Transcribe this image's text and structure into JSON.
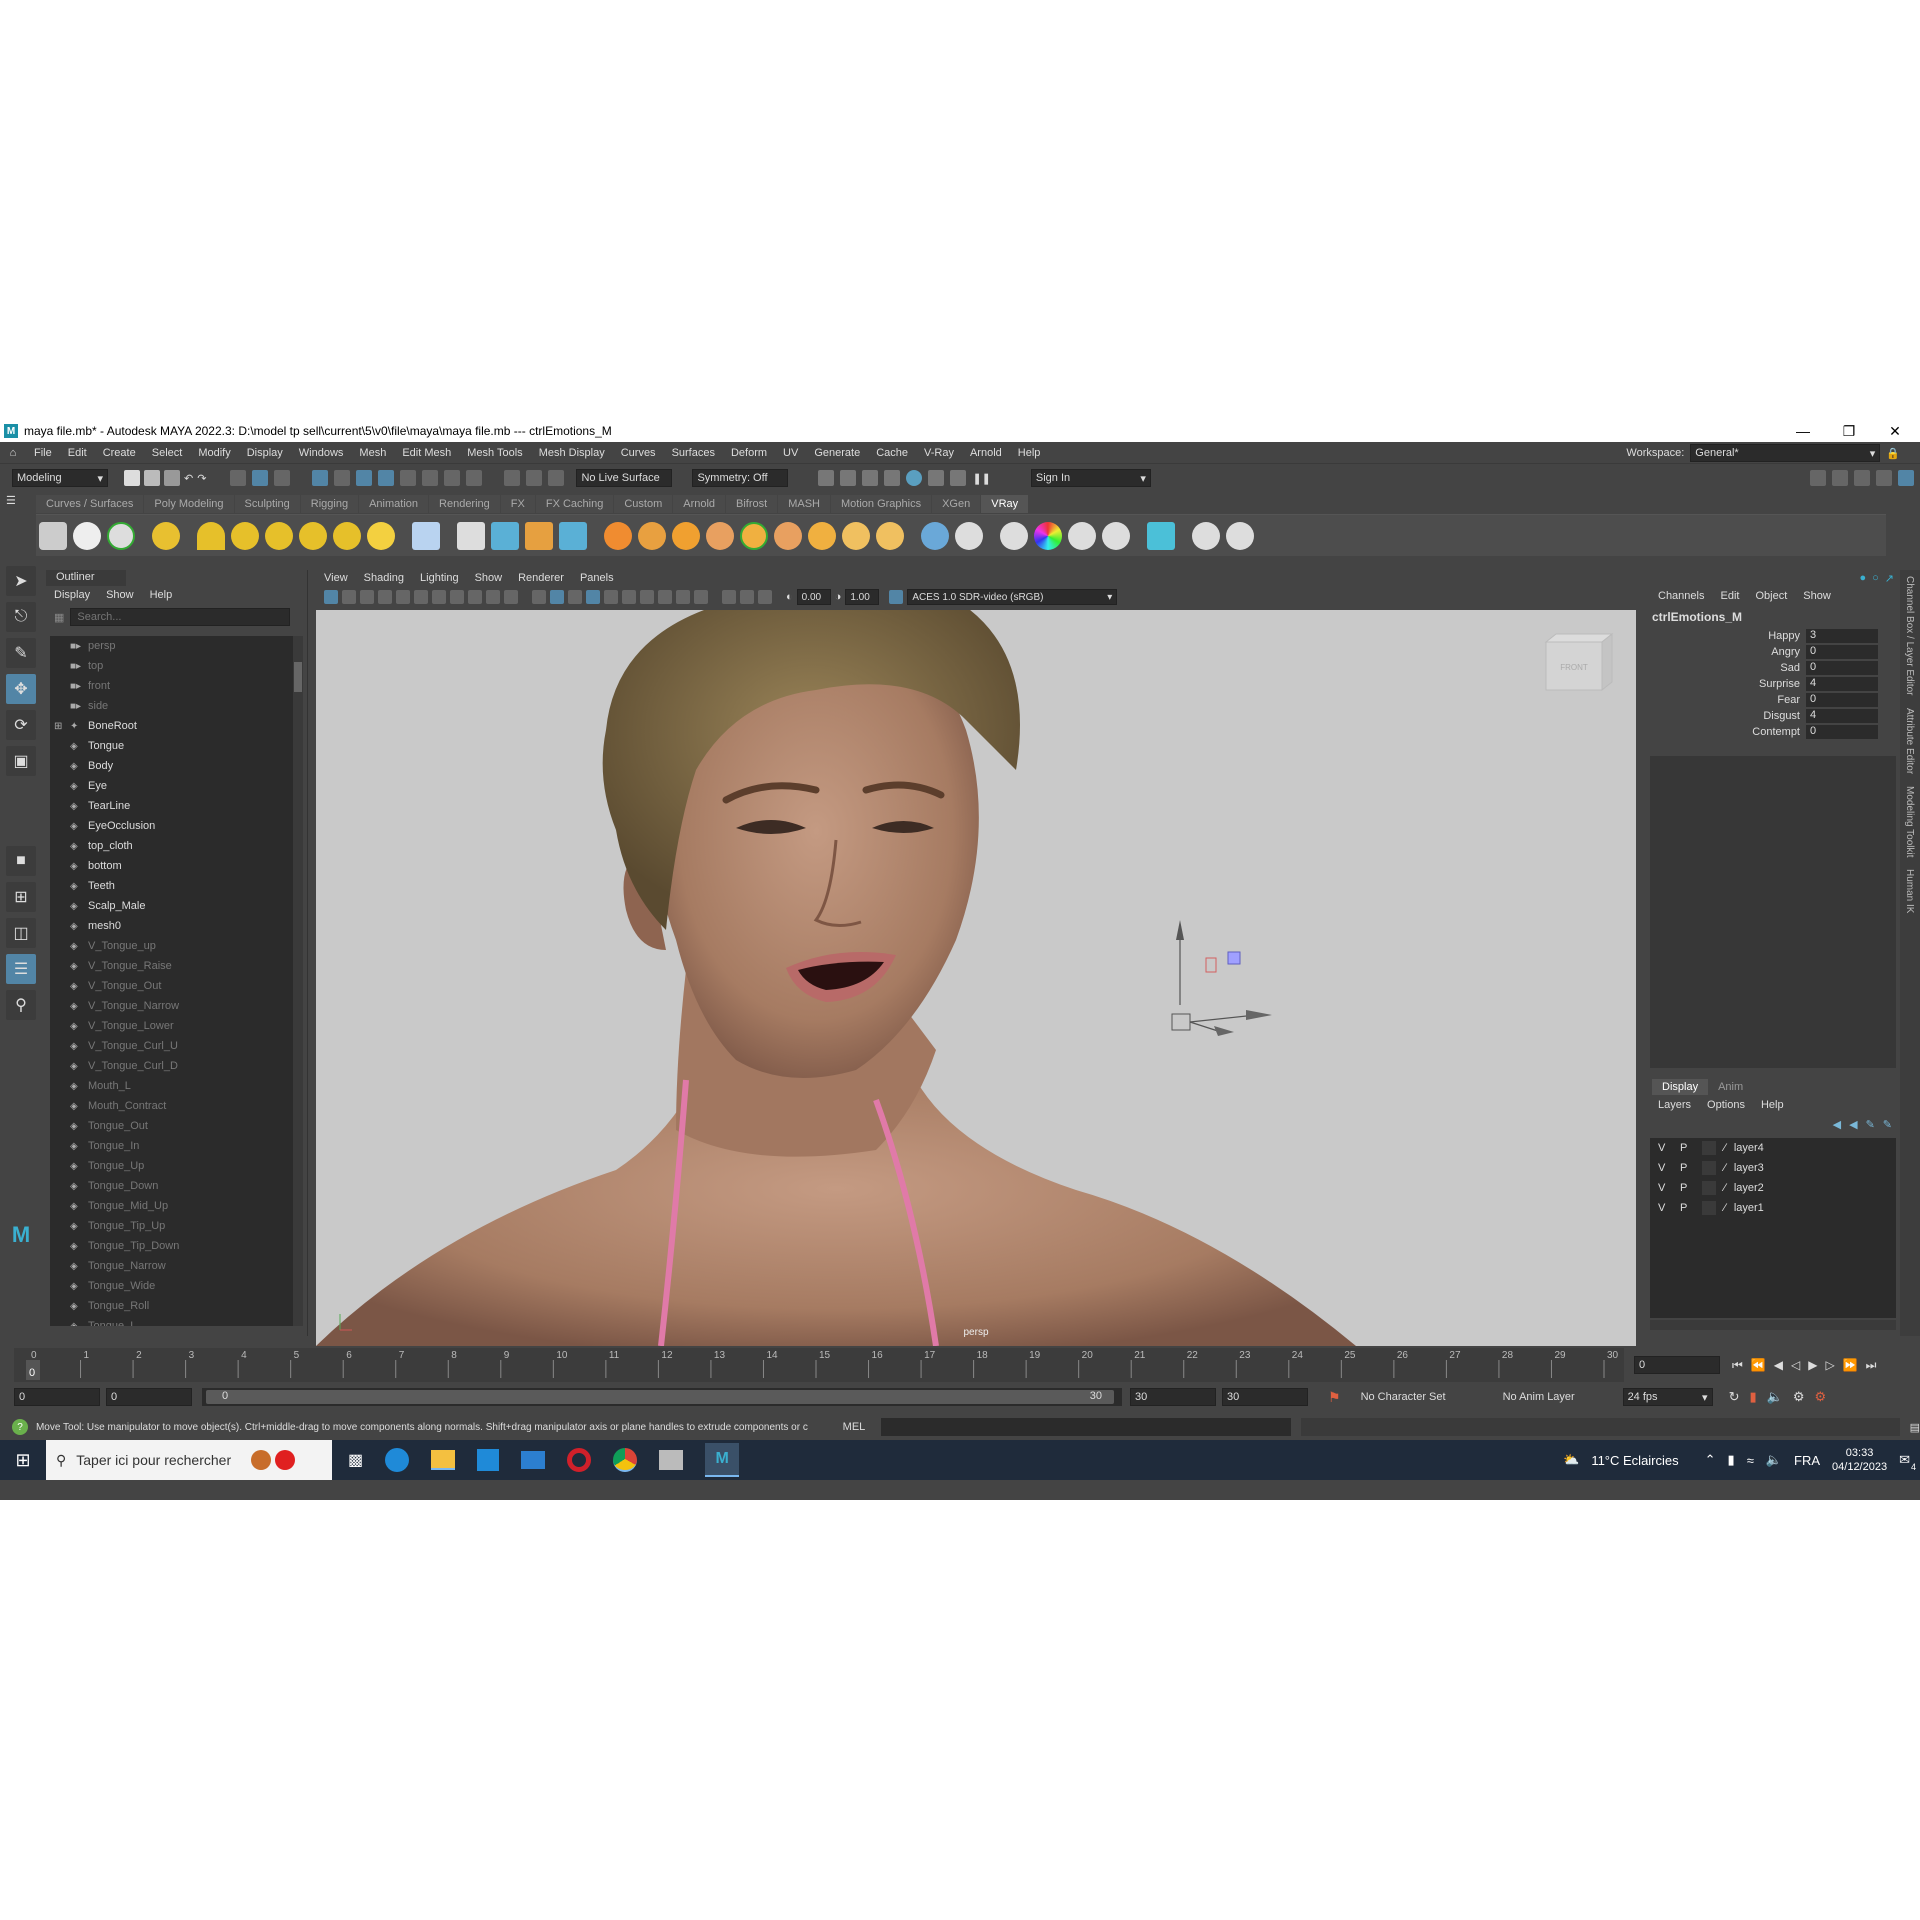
{
  "window": {
    "title": "maya file.mb* - Autodesk MAYA 2022.3: D:\\model tp sell\\current\\5\\v0\\file\\maya\\maya file.mb  ---  ctrlEmotions_M",
    "logo": "M"
  },
  "menubar": [
    "File",
    "Edit",
    "Create",
    "Select",
    "Modify",
    "Display",
    "Windows",
    "Mesh",
    "Edit Mesh",
    "Mesh Tools",
    "Mesh Display",
    "Curves",
    "Surfaces",
    "Deform",
    "UV",
    "Generate",
    "Cache",
    "V-Ray",
    "Arnold",
    "Help"
  ],
  "workspace": {
    "label": "Workspace:",
    "value": "General*"
  },
  "statusline": {
    "mode": "Modeling",
    "live_surface": "No Live Surface",
    "symmetry": "Symmetry: Off",
    "sign_in": "Sign In"
  },
  "shelf_tabs": [
    "Curves / Surfaces",
    "Poly Modeling",
    "Sculpting",
    "Rigging",
    "Animation",
    "Rendering",
    "FX",
    "FX Caching",
    "Custom",
    "Arnold",
    "Bifrost",
    "MASH",
    "Motion Graphics",
    "XGen",
    "VRay"
  ],
  "shelf_active": "VRay",
  "outliner": {
    "title": "Outliner",
    "menu": [
      "Display",
      "Show",
      "Help"
    ],
    "search_placeholder": "Search...",
    "items": [
      {
        "label": "persp",
        "kind": "camera",
        "dim": true
      },
      {
        "label": "top",
        "kind": "camera",
        "dim": true
      },
      {
        "label": "front",
        "kind": "camera",
        "dim": true
      },
      {
        "label": "side",
        "kind": "camera",
        "dim": true
      },
      {
        "label": "BoneRoot",
        "kind": "joint",
        "dim": false
      },
      {
        "label": "Tongue",
        "kind": "mesh",
        "dim": false
      },
      {
        "label": "Body",
        "kind": "mesh",
        "dim": false
      },
      {
        "label": "Eye",
        "kind": "mesh",
        "dim": false
      },
      {
        "label": "TearLine",
        "kind": "mesh",
        "dim": false
      },
      {
        "label": "EyeOcclusion",
        "kind": "mesh",
        "dim": false
      },
      {
        "label": "top_cloth",
        "kind": "mesh",
        "dim": false
      },
      {
        "label": "bottom",
        "kind": "mesh",
        "dim": false
      },
      {
        "label": "Teeth",
        "kind": "mesh",
        "dim": false
      },
      {
        "label": "Scalp_Male",
        "kind": "mesh",
        "dim": false
      },
      {
        "label": "mesh0",
        "kind": "mesh",
        "dim": false
      },
      {
        "label": "V_Tongue_up",
        "kind": "mesh",
        "dim": true
      },
      {
        "label": "V_Tongue_Raise",
        "kind": "mesh",
        "dim": true
      },
      {
        "label": "V_Tongue_Out",
        "kind": "mesh",
        "dim": true
      },
      {
        "label": "V_Tongue_Narrow",
        "kind": "mesh",
        "dim": true
      },
      {
        "label": "V_Tongue_Lower",
        "kind": "mesh",
        "dim": true
      },
      {
        "label": "V_Tongue_Curl_U",
        "kind": "mesh",
        "dim": true
      },
      {
        "label": "V_Tongue_Curl_D",
        "kind": "mesh",
        "dim": true
      },
      {
        "label": "Mouth_L",
        "kind": "mesh",
        "dim": true
      },
      {
        "label": "Mouth_Contract",
        "kind": "mesh",
        "dim": true
      },
      {
        "label": "Tongue_Out",
        "kind": "mesh",
        "dim": true
      },
      {
        "label": "Tongue_In",
        "kind": "mesh",
        "dim": true
      },
      {
        "label": "Tongue_Up",
        "kind": "mesh",
        "dim": true
      },
      {
        "label": "Tongue_Down",
        "kind": "mesh",
        "dim": true
      },
      {
        "label": "Tongue_Mid_Up",
        "kind": "mesh",
        "dim": true
      },
      {
        "label": "Tongue_Tip_Up",
        "kind": "mesh",
        "dim": true
      },
      {
        "label": "Tongue_Tip_Down",
        "kind": "mesh",
        "dim": true
      },
      {
        "label": "Tongue_Narrow",
        "kind": "mesh",
        "dim": true
      },
      {
        "label": "Tongue_Wide",
        "kind": "mesh",
        "dim": true
      },
      {
        "label": "Tongue_Roll",
        "kind": "mesh",
        "dim": true
      },
      {
        "label": "Tongue_L",
        "kind": "mesh",
        "dim": true
      }
    ]
  },
  "viewport": {
    "menu": [
      "View",
      "Shading",
      "Lighting",
      "Show",
      "Renderer",
      "Panels"
    ],
    "exposure": "0.00",
    "gamma": "1.00",
    "colorspace": "ACES 1.0 SDR-video (sRGB)",
    "camera_label": "persp",
    "viewcube_label": "FRONT"
  },
  "channelbox": {
    "menu": [
      "Channels",
      "Edit",
      "Object",
      "Show"
    ],
    "object": "ctrlEmotions_M",
    "channels": [
      {
        "name": "Happy",
        "value": "3"
      },
      {
        "name": "Angry",
        "value": "0"
      },
      {
        "name": "Sad",
        "value": "0"
      },
      {
        "name": "Surprise",
        "value": "4"
      },
      {
        "name": "Fear",
        "value": "0"
      },
      {
        "name": "Disgust",
        "value": "4"
      },
      {
        "name": "Contempt",
        "value": "0"
      }
    ]
  },
  "layer_editor": {
    "tabs": [
      "Display",
      "Anim"
    ],
    "menu": [
      "Layers",
      "Options",
      "Help"
    ],
    "layers": [
      {
        "v": "V",
        "p": "P",
        "name": "layer4"
      },
      {
        "v": "V",
        "p": "P",
        "name": "layer3"
      },
      {
        "v": "V",
        "p": "P",
        "name": "layer2"
      },
      {
        "v": "V",
        "p": "P",
        "name": "layer1"
      }
    ]
  },
  "side_tabs": [
    "Channel Box / Layer Editor",
    "Attribute Editor",
    "Modeling Toolkit",
    "Human IK"
  ],
  "timeline": {
    "ticks": [
      "0",
      "1",
      "2",
      "3",
      "4",
      "5",
      "6",
      "7",
      "8",
      "9",
      "10",
      "11",
      "12",
      "13",
      "14",
      "15",
      "16",
      "17",
      "18",
      "19",
      "20",
      "21",
      "22",
      "23",
      "24",
      "25",
      "26",
      "27",
      "28",
      "29",
      "30"
    ],
    "current": "0",
    "current_field": "0"
  },
  "range": {
    "start": "0",
    "playback_start": "0",
    "slider_start": "0",
    "slider_end": "30",
    "playback_end": "30",
    "end": "30",
    "character_set": "No Character Set",
    "anim_layer": "No Anim Layer",
    "fps": "24 fps"
  },
  "helpline": {
    "text": "Move Tool: Use manipulator to move object(s). Ctrl+middle-drag to move components along normals. Shift+drag manipulator axis or plane handles to extrude components or c",
    "cmd_lang": "MEL"
  },
  "taskbar": {
    "search_placeholder": "Taper ici pour rechercher",
    "weather": "11°C  Eclaircies",
    "lang": "FRA",
    "time": "03:33",
    "date": "04/12/2023",
    "notifications": "4"
  },
  "colors": {
    "accent": "#5285a6",
    "maya_teal": "#1a8fa6"
  }
}
